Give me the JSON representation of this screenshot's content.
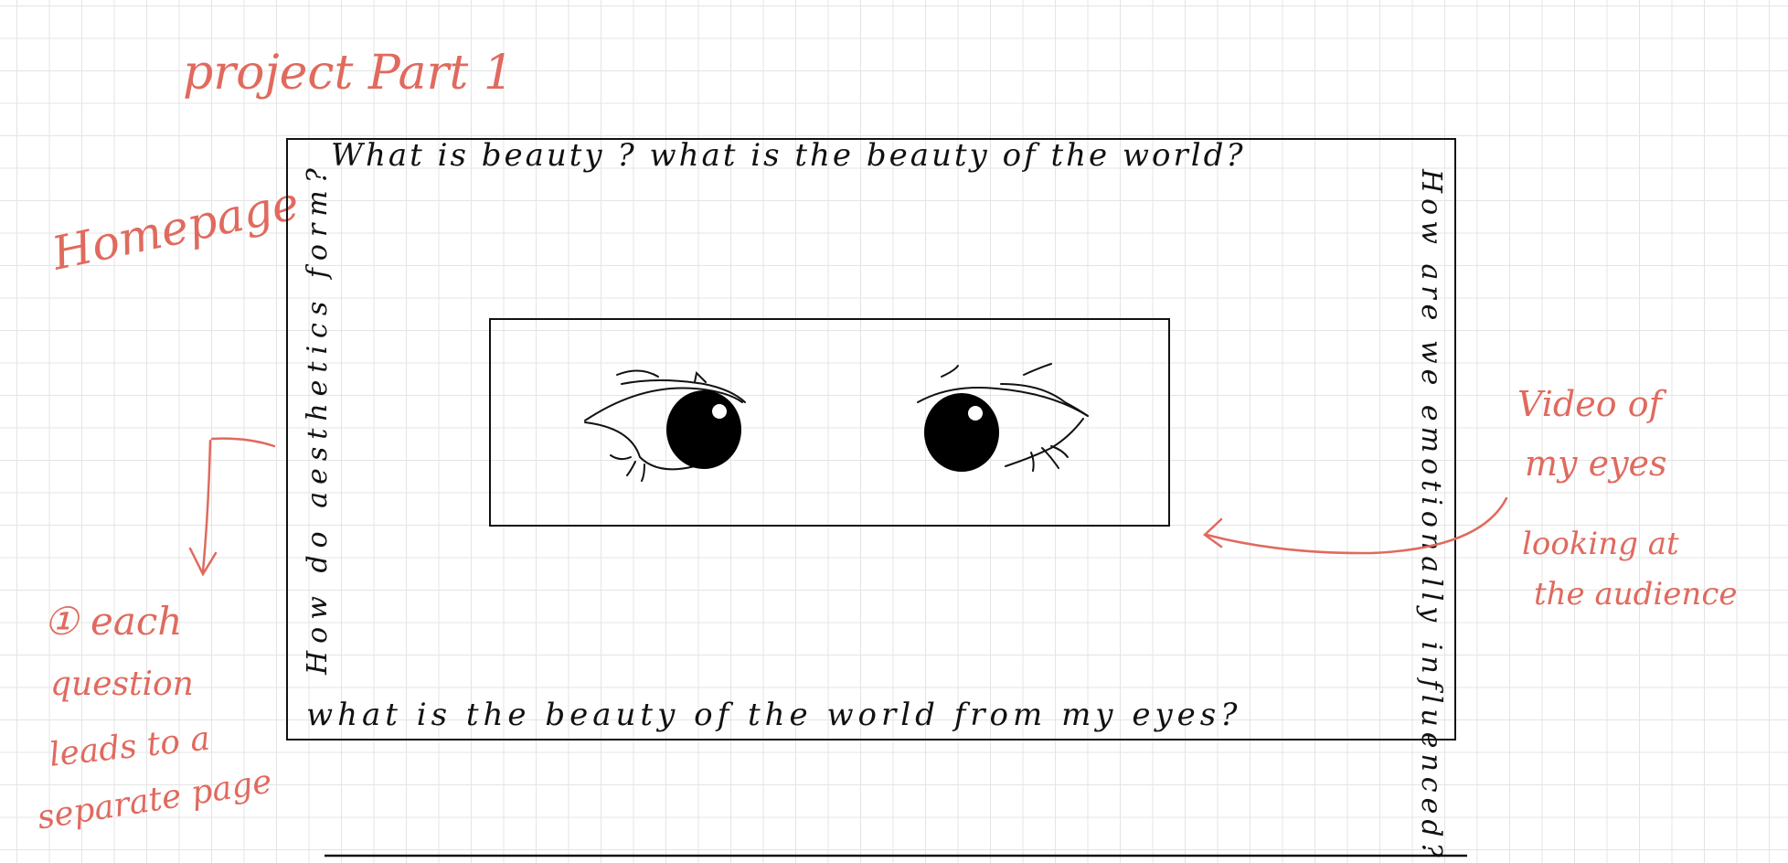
{
  "annotations": {
    "project_title": "project Part 1",
    "page_label": "Homepage",
    "video_note_line1": "Video of",
    "video_note_line2": "my eyes",
    "video_note_line3": "looking at",
    "video_note_line4": "the audience",
    "question_note_line1": "① each",
    "question_note_line2": "question",
    "question_note_line3": "leads to a",
    "question_note_line4": "separate page"
  },
  "homepage": {
    "top_question": "What is beauty ? what is the beauty of the world?",
    "left_question": "How do aesthetics form?",
    "right_question": "How are we emotionally influenced?",
    "bottom_question": "what is the beauty of the world from my eyes?"
  },
  "colors": {
    "annotation": "#e06a5e",
    "ink": "#111111",
    "grid": "#e4e4e4"
  }
}
